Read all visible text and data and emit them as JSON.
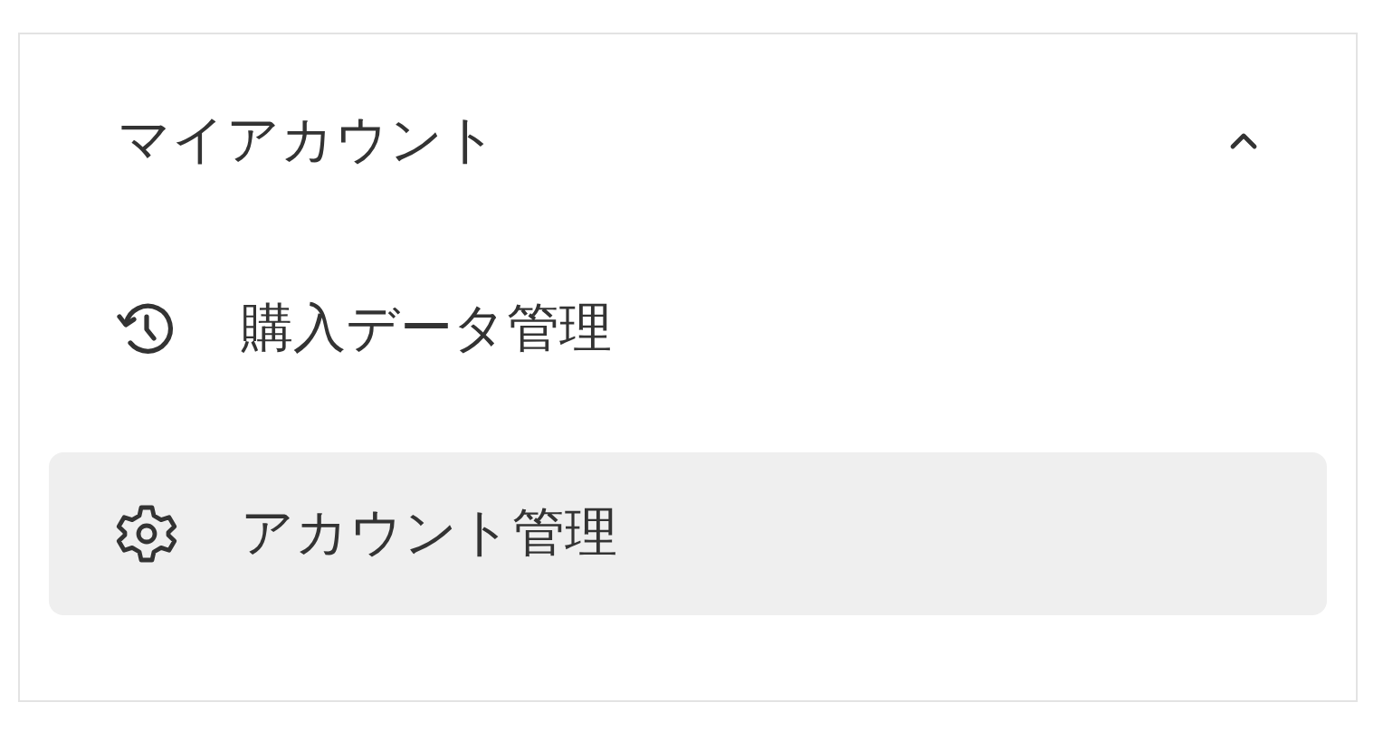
{
  "menu": {
    "title": "マイアカウント",
    "expanded": true,
    "items": [
      {
        "kind": "history",
        "label": "購入データ管理",
        "selected": false
      },
      {
        "kind": "settings",
        "label": "アカウント管理",
        "selected": true
      }
    ]
  }
}
